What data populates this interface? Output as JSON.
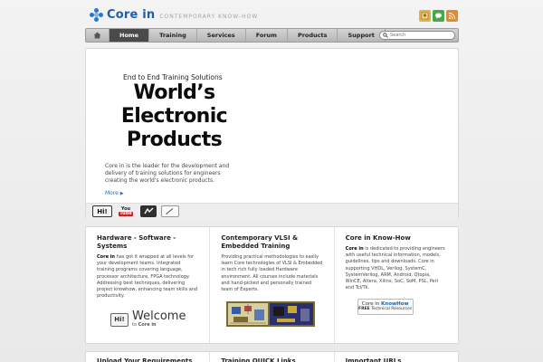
{
  "header": {
    "brand": "Core in",
    "tagline": "CONTEMPORARY KNOW-HOW",
    "icons": [
      "badge-icon",
      "chat-icon",
      "rss-icon"
    ]
  },
  "nav": {
    "items": [
      {
        "label": "Home"
      },
      {
        "label": "Training"
      },
      {
        "label": "Services"
      },
      {
        "label": "Forum"
      },
      {
        "label": "Products"
      },
      {
        "label": "Support"
      }
    ],
    "search_placeholder": "Search"
  },
  "hero": {
    "kicker": "End to End Training Solutions",
    "title_line1": "World’s",
    "title_line2": "Electronic",
    "title_line3": "Products",
    "description": "Core in is the leader for the development and delivery of training solutions for engineers creating the world's electronic products.",
    "more": "More",
    "strip": {
      "hi": "Hi!",
      "youtube_top": "You",
      "youtube_bottom": "Tube"
    }
  },
  "cards": [
    {
      "title": "Hardware - Software - Systems",
      "lead": "Core in",
      "body": " has got it wrapped at all levels for your development teams. Integrated training programs covering language, processor architecture, FPGA technology. Addressing best techniques, delivering project knowhow, enhancing team skills and productivity.",
      "welcome_hi": "Hi!",
      "welcome": "Welcome",
      "welcome_to": "to",
      "welcome_brand": "Core in"
    },
    {
      "title": "Contemporary VLSI & Embedded Training",
      "body": "Providing practical methodologies to easily learn Core technologies of VLSI & Embedded in tech rich fully loaded Hardware environment. All courses include materials and hand-picked and personally trained team of Experts."
    },
    {
      "title": "Core in Know-How",
      "lead": "Core in",
      "body": " is dedicated to providing engineers with useful technical information, models, guidelines, tips and downloads. Core in supporting VHDL, Verilog, SystemC, SystemVerilog, ARM, Android, Qtopia, WinCE, Altera, Xilinx, SoC, SoM, PSL, Perl and Tcl/Tk.",
      "badge_prefix": "Core in ",
      "badge_main": "KnowHow",
      "badge_free": "FREE",
      "badge_sub": " Technical Resources"
    }
  ],
  "cards2": [
    {
      "title": "Upload Your Requirements"
    },
    {
      "title": "Training QUICK Links"
    },
    {
      "title": "Important URLs"
    }
  ],
  "colors": {
    "accent": "#2a78c8",
    "nav_active": "#4a4a4a",
    "link": "#2a6fbf"
  }
}
